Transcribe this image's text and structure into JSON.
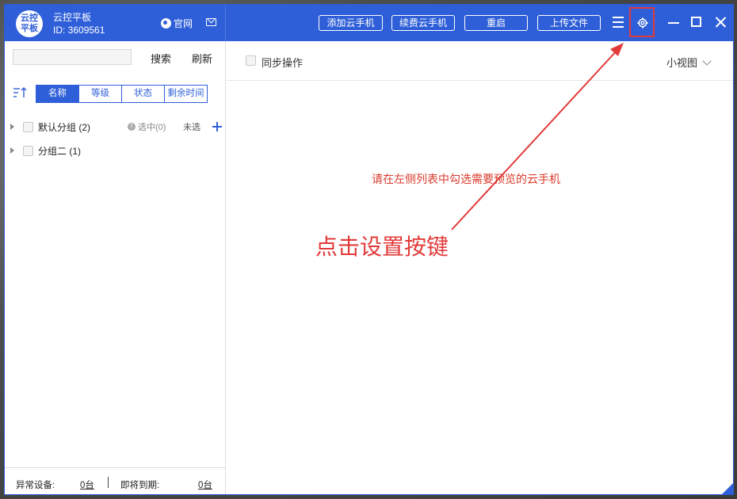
{
  "app": {
    "logo_text": "云控平板",
    "name": "云控平板",
    "id_text": "ID: 3609561",
    "site_link": "官网"
  },
  "toolbar": {
    "add_phone": "添加云手机",
    "renew_phone": "续费云手机",
    "restart": "重启",
    "upload_file": "上传文件"
  },
  "left": {
    "search_placeholder": "",
    "search_btn": "搜索",
    "refresh_btn": "刷新",
    "sort_tabs": [
      {
        "label": "名称",
        "active": true
      },
      {
        "label": "等级",
        "active": false
      },
      {
        "label": "状态",
        "active": false
      },
      {
        "label": "剩余时间",
        "active": false
      }
    ],
    "groups": [
      {
        "label": "默认分组  (2)",
        "selected": "选中(0)",
        "unselected": "未选"
      },
      {
        "label": "分组二  (1)"
      }
    ],
    "footer": {
      "abnormal_label": "异常设备:",
      "abnormal_count": "0台",
      "expiring_label": "即将到期:",
      "expiring_count": "0台"
    }
  },
  "right": {
    "sync_label": "同步操作",
    "view_mode": "小视图",
    "hint": "请在左侧列表中勾选需要预览的云手机"
  },
  "annotation": {
    "text": "点击设置按键",
    "color": "#e23a3a"
  },
  "colors": {
    "brand": "#2f5fd8",
    "hint": "#d93a2a"
  }
}
